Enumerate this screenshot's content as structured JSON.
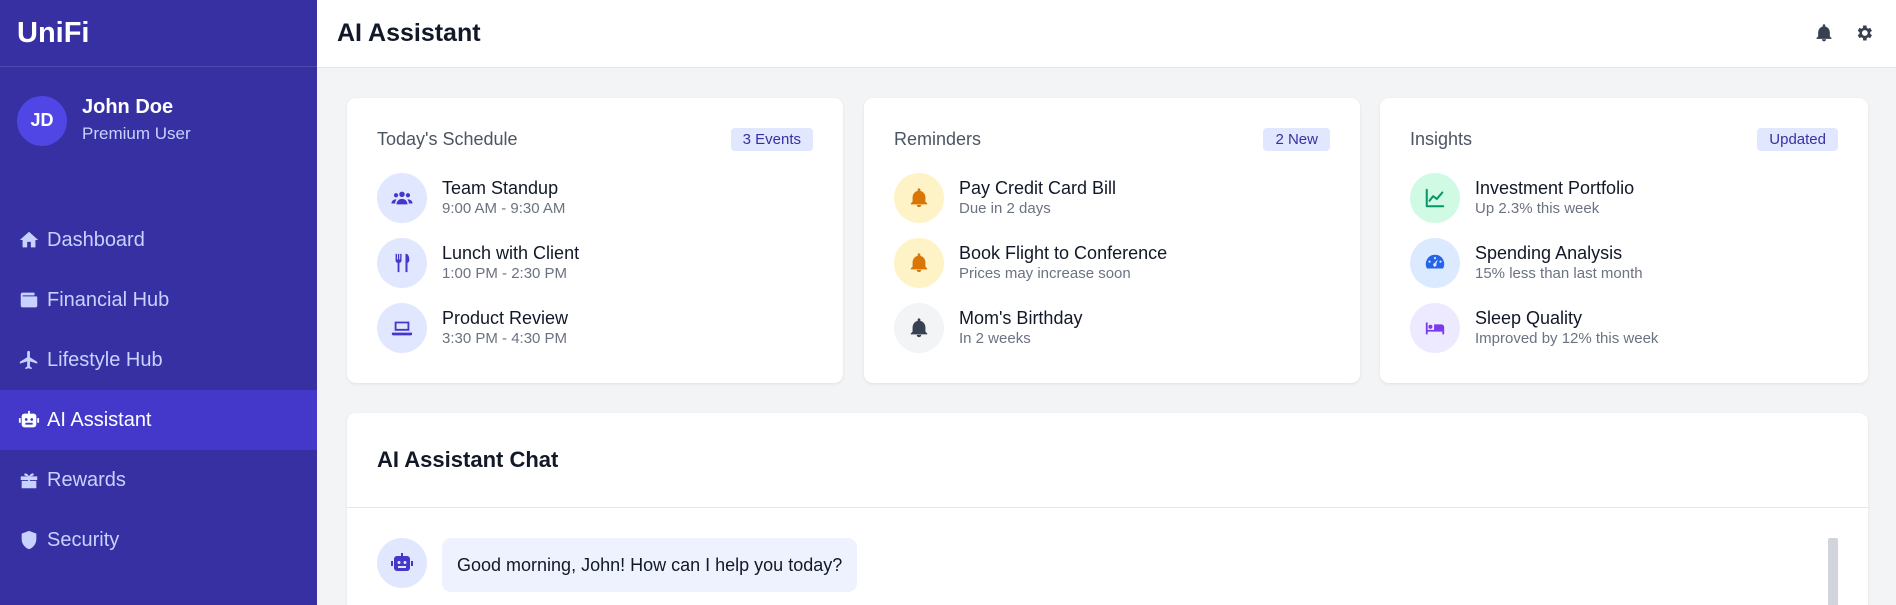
{
  "brand": "UniFi",
  "user": {
    "initials": "JD",
    "name": "John Doe",
    "role": "Premium User"
  },
  "nav": [
    {
      "label": "Dashboard",
      "icon": "home-icon"
    },
    {
      "label": "Financial Hub",
      "icon": "wallet-icon"
    },
    {
      "label": "Lifestyle Hub",
      "icon": "plane-icon"
    },
    {
      "label": "AI Assistant",
      "icon": "robot-icon",
      "active": true
    },
    {
      "label": "Rewards",
      "icon": "gift-icon"
    },
    {
      "label": "Security",
      "icon": "shield-icon"
    }
  ],
  "header": {
    "title": "AI Assistant",
    "icons": [
      "bell-icon",
      "gear-icon"
    ]
  },
  "schedule": {
    "title": "Today's Schedule",
    "badge": "3 Events",
    "items": [
      {
        "title": "Team Standup",
        "sub": "9:00 AM - 9:30 AM",
        "icon": "users-icon"
      },
      {
        "title": "Lunch with Client",
        "sub": "1:00 PM - 2:30 PM",
        "icon": "utensils-icon"
      },
      {
        "title": "Product Review",
        "sub": "3:30 PM - 4:30 PM",
        "icon": "laptop-icon"
      }
    ]
  },
  "reminders": {
    "title": "Reminders",
    "badge": "2 New",
    "items": [
      {
        "title": "Pay Credit Card Bill",
        "sub": "Due in 2 days",
        "icon": "bell-icon"
      },
      {
        "title": "Book Flight to Conference",
        "sub": "Prices may increase soon",
        "icon": "bell-icon"
      },
      {
        "title": "Mom's Birthday",
        "sub": "In 2 weeks",
        "icon": "bell-icon"
      }
    ]
  },
  "insights": {
    "title": "Insights",
    "badge": "Updated",
    "items": [
      {
        "title": "Investment Portfolio",
        "sub": "Up 2.3% this week",
        "icon": "chart-line-icon"
      },
      {
        "title": "Spending Analysis",
        "sub": "15% less than last month",
        "icon": "gauge-icon"
      },
      {
        "title": "Sleep Quality",
        "sub": "Improved by 12% this week",
        "icon": "bed-icon"
      }
    ]
  },
  "chat": {
    "title": "AI Assistant Chat",
    "messages": [
      {
        "from": "bot",
        "text": "Good morning, John! How can I help you today?"
      }
    ]
  },
  "colors": {
    "sidebar": "#3730a3",
    "sidebar_active": "#4338ca",
    "accent": "#4f46e5",
    "badge_bg": "#e0e7ff"
  }
}
